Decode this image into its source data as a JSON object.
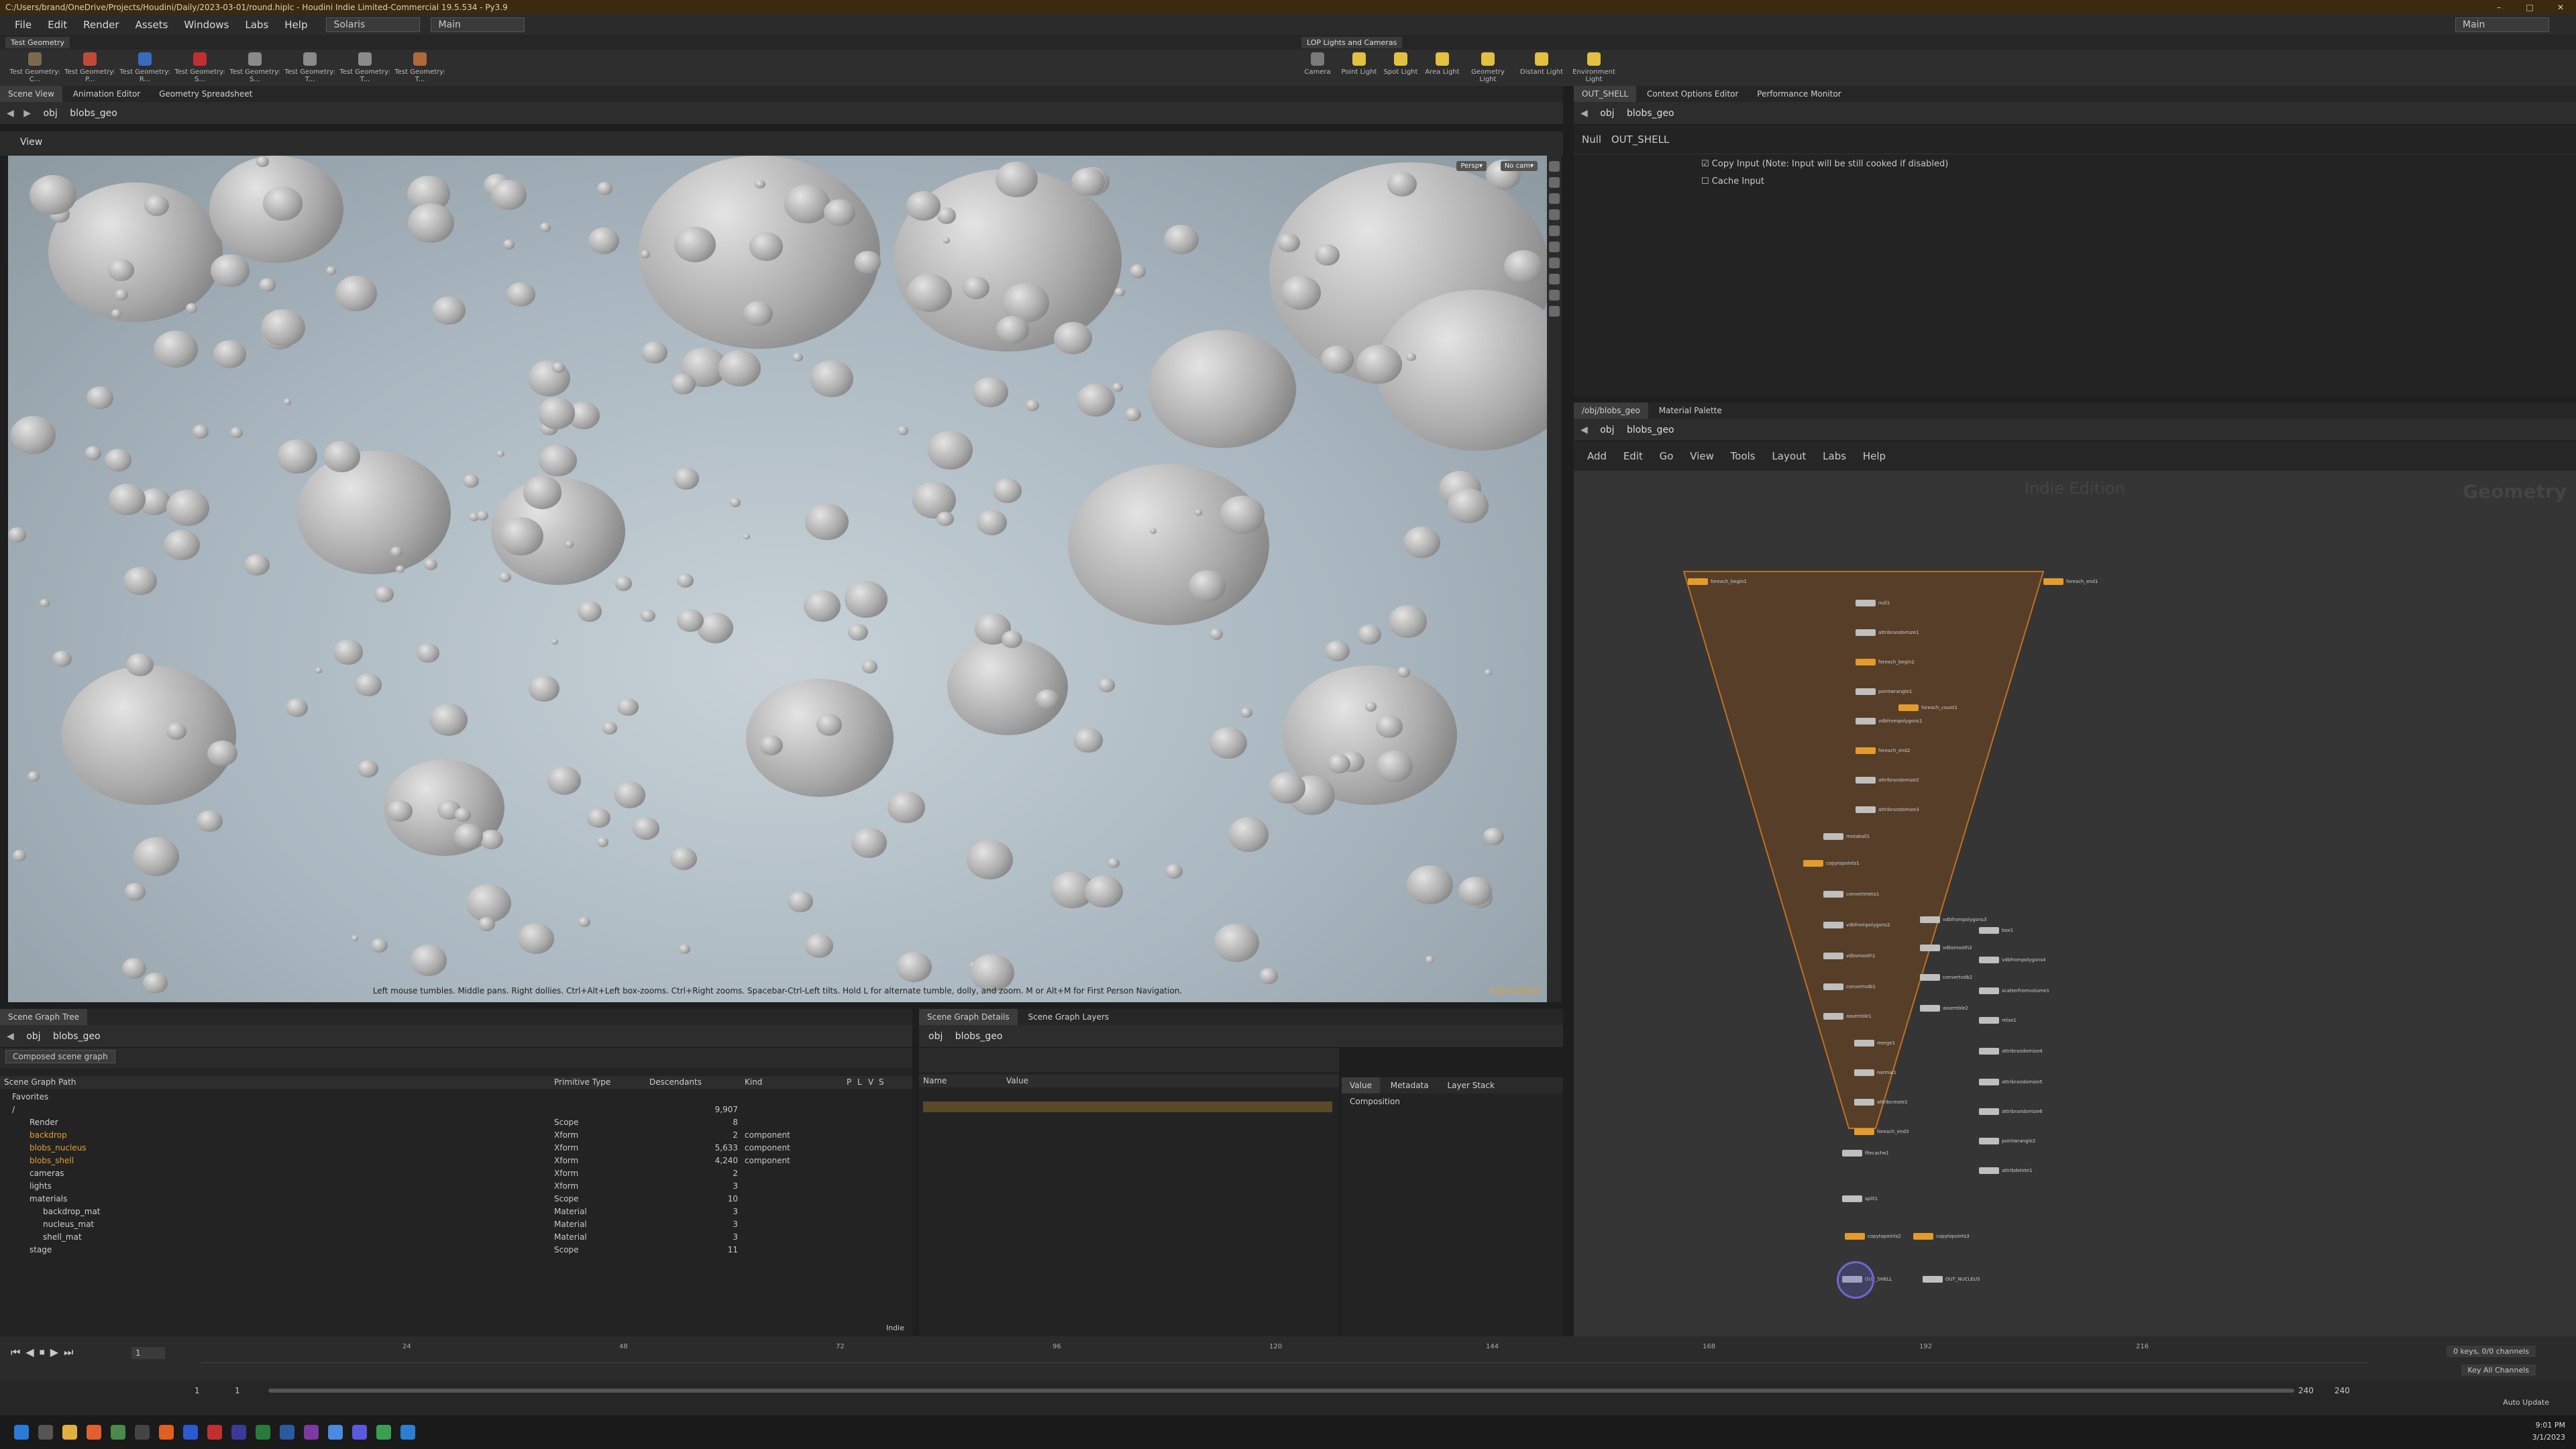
{
  "title_bar": {
    "text": "C:/Users/brand/OneDrive/Projects/Houdini/Daily/2023-03-01/round.hiplc - Houdini Indie Limited-Commercial 19.5.534 - Py3.9",
    "controls": [
      "–",
      "□",
      "✕"
    ]
  },
  "menu": {
    "items": [
      "File",
      "Edit",
      "Render",
      "Assets",
      "Windows",
      "Labs",
      "Help"
    ],
    "context": "Solaris",
    "desktop": "Main",
    "right_desktop": "Main"
  },
  "shelf": {
    "left_tab": "Test Geometry",
    "left_tools": [
      "Test Geometry: C...",
      "Test Geometry: P...",
      "Test Geometry: R...",
      "Test Geometry: S...",
      "Test Geometry: S...",
      "Test Geometry: T...",
      "Test Geometry: T...",
      "Test Geometry: T..."
    ],
    "right_tab": "LOP Lights and Cameras",
    "right_tools": [
      "Camera",
      "Point Light",
      "Spot Light",
      "Area Light",
      "Geometry Light",
      "Distant Light",
      "Environment Light"
    ]
  },
  "left_tabs": [
    "Scene View",
    "Animation Editor",
    "Geometry Spreadsheet"
  ],
  "right_top_tabs": [
    "OUT_SHELL",
    "Context Options Editor",
    "Performance Monitor"
  ],
  "path": {
    "root": "obj",
    "node": "blobs_geo"
  },
  "viewport": {
    "label": "View",
    "persp": "Persp▾",
    "cam": "No cam▾",
    "hint": "Left mouse tumbles. Middle pans. Right dollies. Ctrl+Alt+Left box-zooms. Ctrl+Right zooms. Spacebar-Ctrl-Left tilts. Hold L for alternate tumble, dolly, and zoom.    M or Alt+M for First Person Navigation.",
    "watermark": "Indie Edition"
  },
  "params": {
    "type": "Null",
    "name": "OUT_SHELL",
    "copy_input": "Copy Input (Note: Input will be still cooked if disabled)",
    "cache_input": "Cache Input"
  },
  "network": {
    "tabs": [
      "/obj/blobs_geo",
      "Material Palette"
    ],
    "menu": [
      "Add",
      "Edit",
      "Go",
      "View",
      "Tools",
      "Layout",
      "Labs",
      "Help"
    ],
    "watermark": "Indie Edition",
    "context_label": "Geometry",
    "nodes": [
      {
        "label": "foreach_begin1",
        "orange": true
      },
      {
        "label": "foreach_end1",
        "orange": true
      },
      {
        "label": "null1",
        "orange": false
      },
      {
        "label": "attribrandomize1",
        "orange": false
      },
      {
        "label": "foreach_begin2",
        "orange": true
      },
      {
        "label": "pointwrangle1",
        "orange": false
      },
      {
        "label": "foreach_count1",
        "orange": true
      },
      {
        "label": "vdbfrompolygons1",
        "orange": false
      },
      {
        "label": "foreach_end2",
        "orange": true
      },
      {
        "label": "attribrandomize2",
        "orange": false
      },
      {
        "label": "attribrandomize3",
        "orange": false
      },
      {
        "label": "metaball1",
        "orange": false
      },
      {
        "label": "copytopoints1",
        "orange": true
      },
      {
        "label": "convertmeta1",
        "orange": false
      },
      {
        "label": "vdbfrompolygons2",
        "orange": false
      },
      {
        "label": "vdbsmooth1",
        "orange": false
      },
      {
        "label": "vdbfrompolygons3",
        "orange": false
      },
      {
        "label": "convertvdb1",
        "orange": false
      },
      {
        "label": "vdbsmooth2",
        "orange": false
      },
      {
        "label": "convertvdb2",
        "orange": false
      },
      {
        "label": "assemble1",
        "orange": false
      },
      {
        "label": "assemble2",
        "orange": false
      },
      {
        "label": "merge1",
        "orange": false
      },
      {
        "label": "normal1",
        "orange": false
      },
      {
        "label": "attribcreate1",
        "orange": false
      },
      {
        "label": "foreach_end3",
        "orange": true
      },
      {
        "label": "filecache1",
        "orange": false
      },
      {
        "label": "split1",
        "orange": false
      },
      {
        "label": "copytopoints2",
        "orange": true
      },
      {
        "label": "copytopoints3",
        "orange": true
      },
      {
        "label": "box1",
        "orange": false
      },
      {
        "label": "vdbfrompolygons4",
        "orange": false
      },
      {
        "label": "scatterfromvolume1",
        "orange": false
      },
      {
        "label": "relax1",
        "orange": false
      },
      {
        "label": "attribrandomize4",
        "orange": false
      },
      {
        "label": "attribrandomize5",
        "orange": false
      },
      {
        "label": "attribrandomize6",
        "orange": false
      },
      {
        "label": "pointwrangle2",
        "orange": false
      },
      {
        "label": "attribdelete1",
        "orange": false
      },
      {
        "label": "OUT_SHELL",
        "orange": false
      },
      {
        "label": "OUT_NUCLEUS",
        "orange": false
      }
    ]
  },
  "scene_tree": {
    "tabs": [
      "Scene Graph Tree"
    ],
    "mode": "Composed scene graph",
    "columns": [
      "Scene Graph Path",
      "Primitive Type",
      "Descendants",
      "Kind",
      "P",
      "L",
      "V",
      "S"
    ],
    "rows": [
      {
        "path": "Favorites",
        "type": "",
        "desc": "",
        "kind": ""
      },
      {
        "path": "/",
        "type": "",
        "desc": "9,907",
        "kind": ""
      },
      {
        "path": "Render",
        "type": "Scope",
        "desc": "8",
        "kind": ""
      },
      {
        "path": "backdrop",
        "type": "Xform",
        "desc": "2",
        "kind": "component"
      },
      {
        "path": "blobs_nucleus",
        "type": "Xform",
        "desc": "5,633",
        "kind": "component"
      },
      {
        "path": "blobs_shell",
        "type": "Xform",
        "desc": "4,240",
        "kind": "component"
      },
      {
        "path": "cameras",
        "type": "Xform",
        "desc": "2",
        "kind": ""
      },
      {
        "path": "lights",
        "type": "Xform",
        "desc": "3",
        "kind": ""
      },
      {
        "path": "materials",
        "type": "Scope",
        "desc": "10",
        "kind": ""
      },
      {
        "path": "backdrop_mat",
        "type": "Material",
        "desc": "3",
        "kind": ""
      },
      {
        "path": "nucleus_mat",
        "type": "Material",
        "desc": "3",
        "kind": ""
      },
      {
        "path": "shell_mat",
        "type": "Material",
        "desc": "3",
        "kind": ""
      },
      {
        "path": "stage",
        "type": "Scope",
        "desc": "11",
        "kind": ""
      }
    ],
    "footer": "Indie"
  },
  "scene_details": {
    "tabs": [
      "Scene Graph Details",
      "Scene Graph Layers"
    ],
    "columns": [
      "Name",
      "Value"
    ],
    "right_tabs": [
      "Value",
      "Metadata",
      "Layer Stack",
      "Composition"
    ]
  },
  "timeline": {
    "ticks": [
      "24",
      "48",
      "72",
      "96",
      "120",
      "144",
      "168",
      "192",
      "216"
    ],
    "frame": "1",
    "start": "1",
    "start2": "1",
    "end": "240",
    "end2": "240",
    "keys": "0 keys, 0/0 channels",
    "key_all": "Key All Channels",
    "auto_update": "Auto Update"
  },
  "clock": {
    "time": "9:01 PM",
    "date": "3/1/2023"
  },
  "colors": {
    "accent_orange": "#e39b2a",
    "titlebar": "#3a2a10"
  }
}
